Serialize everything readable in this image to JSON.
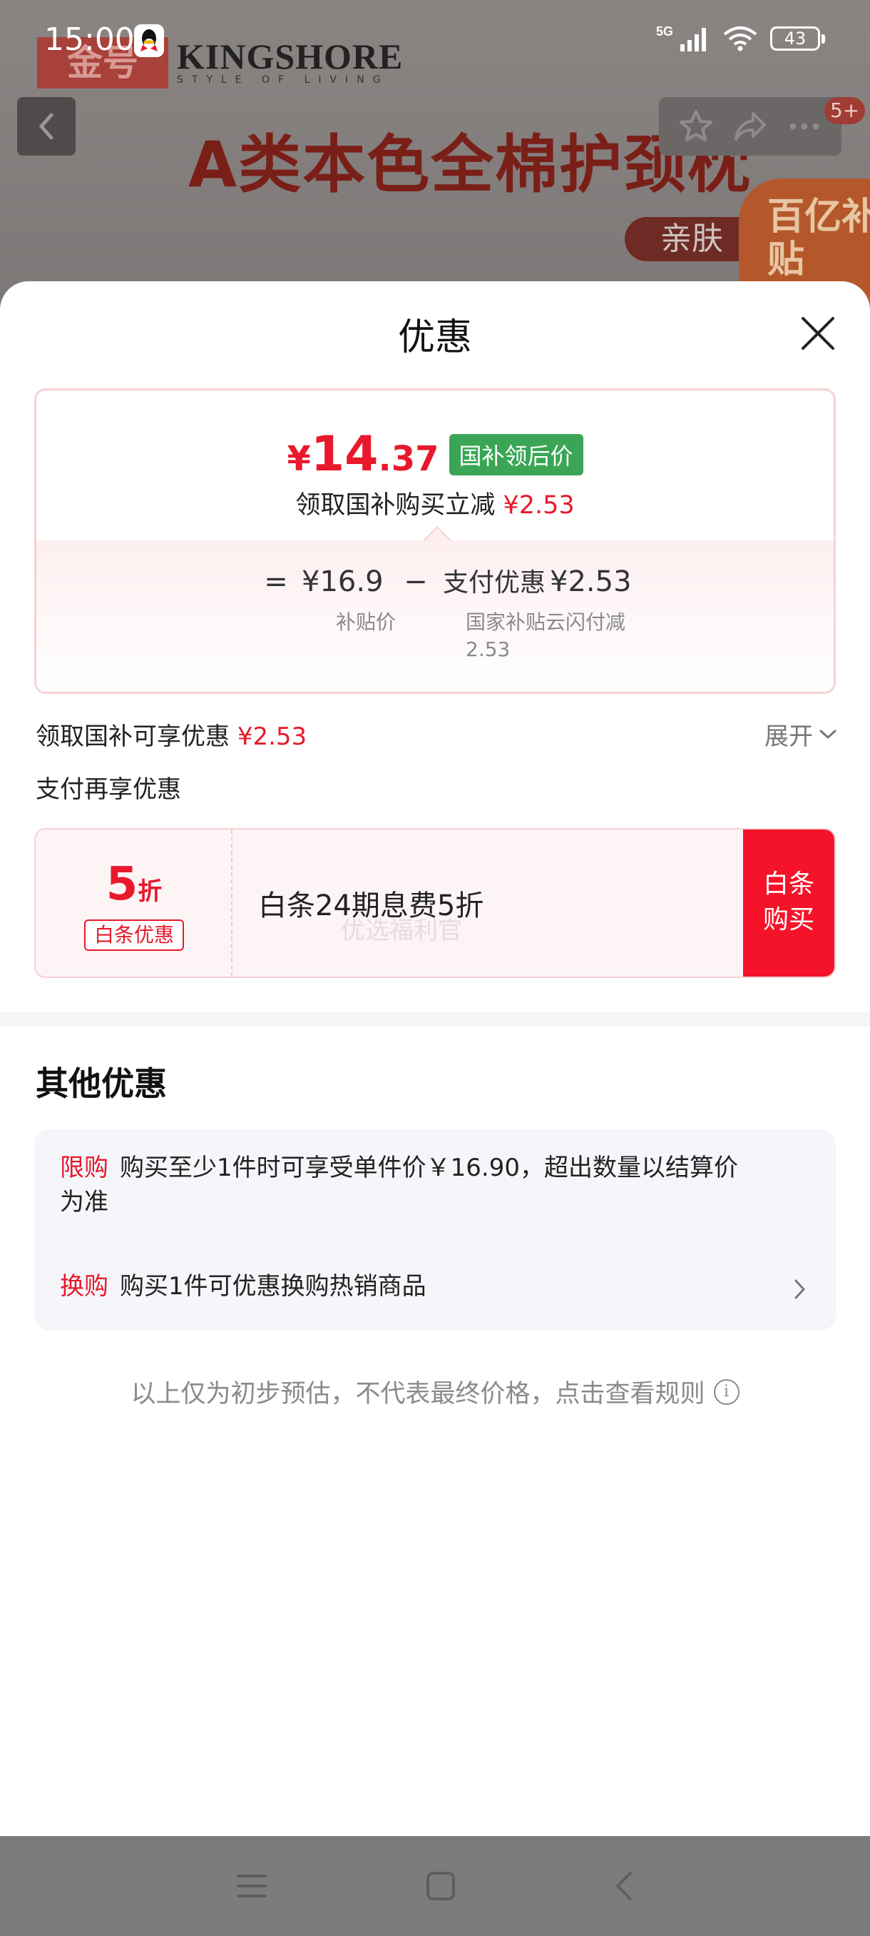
{
  "status_bar": {
    "time": "15:00",
    "network": "5G",
    "battery": "43",
    "icons": [
      "qq-icon",
      "signal-icon",
      "wifi-icon",
      "battery-icon"
    ]
  },
  "background_page": {
    "brand_logo_text": "金号",
    "brand_name": "KINGSHORE",
    "brand_tagline": "STYLE OF LIVING",
    "headline": "A类本色全棉护颈枕",
    "pill_text": "亲肤",
    "badge_text": "百亿补贴",
    "notification_count": "5+"
  },
  "sheet": {
    "title": "优惠",
    "price_card": {
      "price_symbol": "¥",
      "price_int": "14",
      "price_dec": ".37",
      "price_tag": "国补领后价",
      "subsidy_line_label": "领取国补购买立减",
      "subsidy_line_value": "¥2.53",
      "calc": {
        "eq": "=",
        "minus": "−",
        "base_price": "¥16.9",
        "base_label": "补贴价",
        "discount_label": "支付优惠",
        "discount_value": "¥2.53",
        "discount_desc_1": "国家补贴云闪付减",
        "discount_desc_2": "2.53"
      }
    },
    "subsidy_row": {
      "label": "领取国补可享优惠",
      "value": "¥2.53",
      "expand": "展开"
    },
    "pay_row_label": "支付再享优惠",
    "baitiao": {
      "discount_num": "5",
      "discount_unit": "折",
      "tag": "白条优惠",
      "text": "白条24期息费5折",
      "watermark": "优选福利官",
      "button_line1": "白条",
      "button_line2": "购买"
    },
    "other": {
      "title": "其他优惠",
      "items": [
        {
          "key": "限购",
          "text_1": "购买至少1件时可享受单件价￥16.90，超出数量以结算价",
          "text_2": "为准"
        },
        {
          "key": "换购",
          "text_1": "购买1件可优惠换购热销商品"
        }
      ]
    },
    "footnote": "以上仅为初步预估，不代表最终价格，点击查看规则"
  },
  "colors": {
    "accent_red": "#e8192c",
    "tag_green": "#3aa655"
  }
}
